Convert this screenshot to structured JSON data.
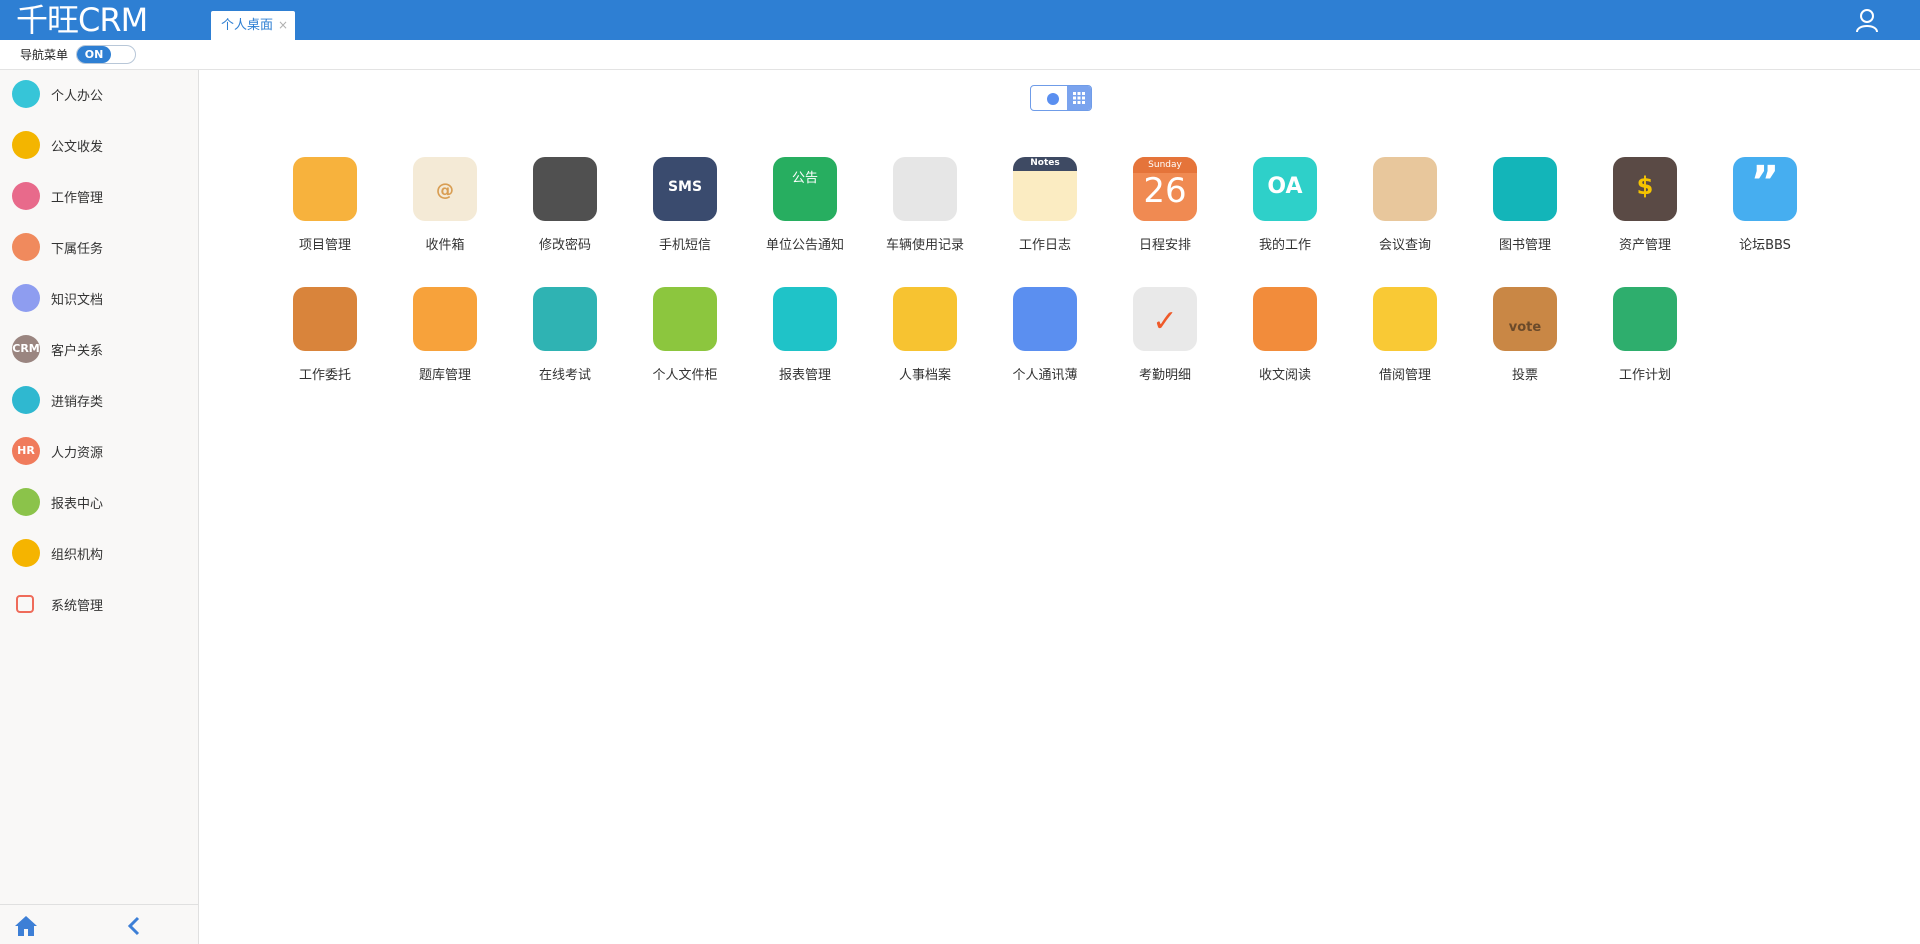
{
  "header": {
    "logo": "千旺CRM",
    "tabs": [
      {
        "label": "个人桌面",
        "close": "×"
      }
    ],
    "user_icon": "user-icon"
  },
  "navbar": {
    "label": "导航菜单",
    "switch_on": "ON"
  },
  "sidebar": {
    "items": [
      {
        "label": "个人办公",
        "icon": "user-icon",
        "color": "#36c5d8",
        "glyph": ""
      },
      {
        "label": "公文收发",
        "icon": "document-icon",
        "color": "#f3b500",
        "glyph": ""
      },
      {
        "label": "工作管理",
        "icon": "pen-icon",
        "color": "#e86a8b",
        "glyph": ""
      },
      {
        "label": "下属任务",
        "icon": "team-icon",
        "color": "#f08a5d",
        "glyph": ""
      },
      {
        "label": "知识文档",
        "icon": "book-icon",
        "color": "#8e9df0",
        "glyph": ""
      },
      {
        "label": "客户关系",
        "icon": "crm-icon",
        "color": "#9a8580",
        "glyph": "CRM"
      },
      {
        "label": "进销存类",
        "icon": "warehouse-icon",
        "color": "#2fb8d0",
        "glyph": ""
      },
      {
        "label": "人力资源",
        "icon": "hr-icon",
        "color": "#f07b5c",
        "glyph": "HR"
      },
      {
        "label": "报表中心",
        "icon": "chart-icon",
        "color": "#8bc34a",
        "glyph": ""
      },
      {
        "label": "组织机构",
        "icon": "gear-icon",
        "color": "#f5b400",
        "glyph": ""
      },
      {
        "label": "系统管理",
        "icon": "window-icon",
        "color": "#ef6b5a",
        "glyph": ""
      }
    ],
    "footer": {
      "home_icon": "home-icon",
      "collapse_icon": "chevron-left-icon"
    }
  },
  "main": {
    "view_toggle": {
      "list_icon": "list-view-icon",
      "grid_icon": "grid-view-icon"
    },
    "apps": [
      {
        "label": "项目管理",
        "icon": "notebook-icon",
        "bg": "#f7b23d",
        "glyph": ""
      },
      {
        "label": "收件箱",
        "icon": "envelope-icon",
        "bg": "#f4ead6",
        "glyph": "@"
      },
      {
        "label": "修改密码",
        "icon": "gear-icon",
        "bg": "#505050",
        "glyph": ""
      },
      {
        "label": "手机短信",
        "icon": "sms-icon",
        "bg": "#3a4b6e",
        "glyph": "SMS"
      },
      {
        "label": "单位公告通知",
        "icon": "notice-board-icon",
        "bg": "#27ae60",
        "glyph": "公告"
      },
      {
        "label": "车辆使用记录",
        "icon": "speedometer-icon",
        "bg": "#e6e6e6",
        "glyph": ""
      },
      {
        "label": "工作日志",
        "icon": "notes-icon",
        "bg": "#fbecc2",
        "glyph": "Notes"
      },
      {
        "label": "日程安排",
        "icon": "calendar-icon",
        "bg": "#f08a52",
        "glyph": "26",
        "sub": "Sunday"
      },
      {
        "label": "我的工作",
        "icon": "oa-icon",
        "bg": "#2ed0c9",
        "glyph": "OA"
      },
      {
        "label": "会议查询",
        "icon": "meeting-icon",
        "bg": "#e8c79c",
        "glyph": ""
      },
      {
        "label": "图书管理",
        "icon": "book-icon",
        "bg": "#13b5b9",
        "glyph": ""
      },
      {
        "label": "资产管理",
        "icon": "wallet-icon",
        "bg": "#5a4a45",
        "glyph": "$"
      },
      {
        "label": "论坛BBS",
        "icon": "quote-icon",
        "bg": "#46aef0",
        "glyph": "”"
      },
      {
        "label": "工作委托",
        "icon": "delegate-icon",
        "bg": "#d9843b",
        "glyph": ""
      },
      {
        "label": "题库管理",
        "icon": "clock-icon",
        "bg": "#f7a23b",
        "glyph": ""
      },
      {
        "label": "在线考试",
        "icon": "coin-icon",
        "bg": "#2fb3b3",
        "glyph": ""
      },
      {
        "label": "个人文件柜",
        "icon": "cabinet-icon",
        "bg": "#8cc63e",
        "glyph": ""
      },
      {
        "label": "报表管理",
        "icon": "report-icon",
        "bg": "#1fc3c8",
        "glyph": ""
      },
      {
        "label": "人事档案",
        "icon": "profile-icon",
        "bg": "#f7c331",
        "glyph": ""
      },
      {
        "label": "个人通讯薄",
        "icon": "contacts-icon",
        "bg": "#5b8ff0",
        "glyph": ""
      },
      {
        "label": "考勤明细",
        "icon": "attendance-icon",
        "bg": "#e9e9e9",
        "glyph": "✓"
      },
      {
        "label": "收文阅读",
        "icon": "read-icon",
        "bg": "#f28c3b",
        "glyph": ""
      },
      {
        "label": "借阅管理",
        "icon": "borrow-icon",
        "bg": "#f9c935",
        "glyph": ""
      },
      {
        "label": "投票",
        "icon": "vote-icon",
        "bg": "#c98745",
        "glyph": "vote"
      },
      {
        "label": "工作计划",
        "icon": "clipboard-icon",
        "bg": "#2eae6d",
        "glyph": ""
      }
    ]
  }
}
